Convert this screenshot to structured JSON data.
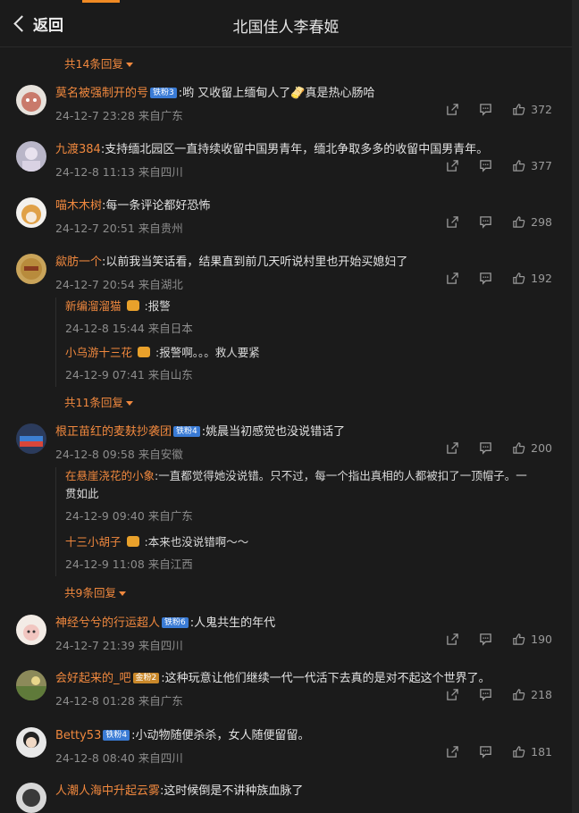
{
  "header": {
    "back_label": "返回",
    "title": "北国佳人李春姬"
  },
  "top_more": "共14条回复",
  "comments": [
    {
      "user": "莫名被强制开的号",
      "badge": "铁粉3",
      "text": ":哟 又收留上缅甸人了🫔真是热心肠哈",
      "time": "24-12-7 23:28 来自广东",
      "likes": "372"
    },
    {
      "user": "九渡384",
      "text": ":支持缅北园区一直持续收留中国男青年，缅北争取多多的收留中国男青年。",
      "time": "24-12-8 11:13 来自四川",
      "likes": "377"
    },
    {
      "user": "喵木木树",
      "text": ":每一条评论都好恐怖",
      "time": "24-12-7 20:51 来自贵州",
      "likes": "298"
    },
    {
      "user": "歘肪一个",
      "text": ":以前我当笑话看，结果直到前几天听说村里也开始买媳妇了",
      "time": "24-12-7 20:54 来自湖北",
      "likes": "192",
      "replies": [
        {
          "user": "新编溜溜猫",
          "text": ":报警",
          "time": "24-12-8 15:44 来自日本"
        },
        {
          "user": "小乌游十三花",
          "text": ":报警啊。。。救人要紧",
          "time": "24-12-9 07:41 来自山东"
        }
      ],
      "more": "共11条回复"
    },
    {
      "user": "根正苗红的麦麸抄袭团",
      "badge": "铁粉4",
      "text": ":姚晨当初感觉也没说错话了",
      "time": "24-12-8 09:58 来自安徽",
      "likes": "200",
      "replies": [
        {
          "user": "在悬崖浇花的小象",
          "text": ":一直都觉得她没说错。只不过，每一个指出真相的人都被扣了一顶帽子。一",
          "text2": "贯如此",
          "time": "24-12-9 09:40 来自广东"
        },
        {
          "user": "十三小胡子",
          "text": ":本来也没说错啊～～",
          "time": "24-12-9 11:08 来自江西"
        }
      ],
      "more": "共9条回复"
    },
    {
      "user": "神经兮兮的行运超人",
      "badge": "铁粉6",
      "text": ":人鬼共生的年代",
      "time": "24-12-7 21:39 来自四川",
      "likes": "190"
    },
    {
      "user": "会好起来的_吧",
      "badge": "金粉2",
      "text": ":这种玩意让他们继续一代一代活下去真的是对不起这个世界了。",
      "time": "24-12-8 01:28 来自广东",
      "likes": "218"
    },
    {
      "user": "Betty53",
      "badge": "铁粉4",
      "text": ":小动物随便杀杀，女人随便留留。",
      "time": "24-12-8 08:40 来自四川",
      "likes": "181"
    },
    {
      "user": "人潮人海中升起云雾",
      "text": ":这时候倒是不讲种族血脉了",
      "time": "",
      "likes": ""
    }
  ]
}
